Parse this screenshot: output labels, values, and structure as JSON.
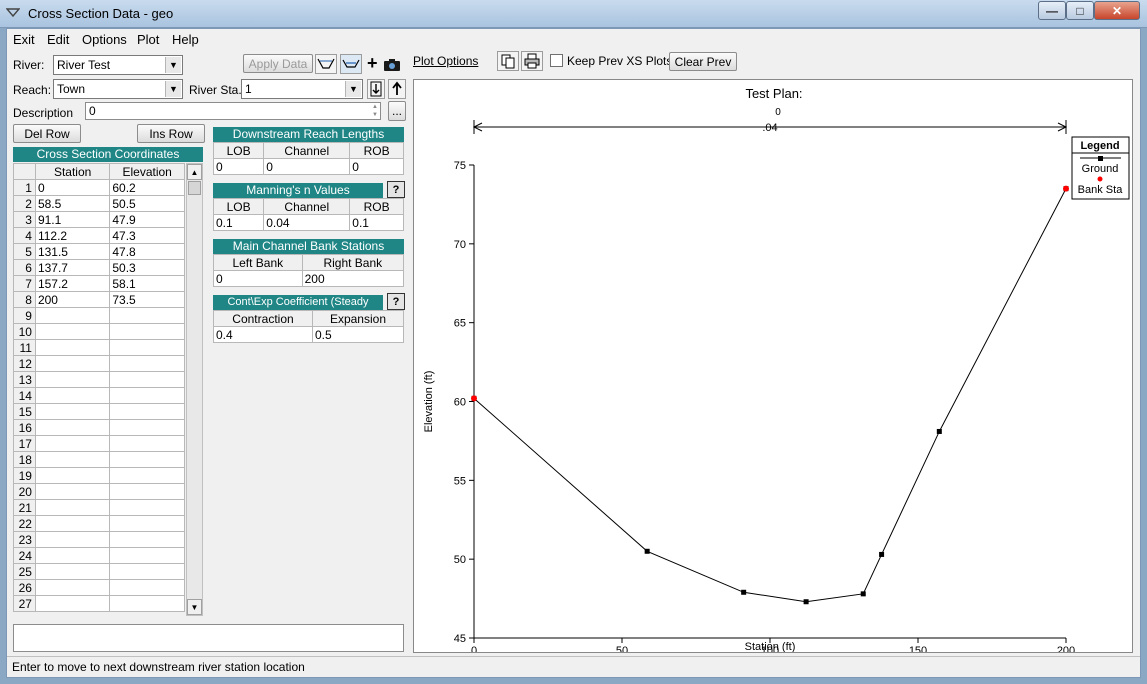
{
  "window": {
    "title": "Cross Section Data - geo"
  },
  "menu": [
    "Exit",
    "Edit",
    "Options",
    "Plot",
    "Help"
  ],
  "river": {
    "label": "River:",
    "value": "River Test"
  },
  "reach": {
    "label": "Reach:",
    "value": "Town"
  },
  "river_sta": {
    "label": "River Sta.:",
    "value": "1"
  },
  "apply_data_label": "Apply Data",
  "description": {
    "label": "Description",
    "value": "0"
  },
  "del_row_label": "Del Row",
  "ins_row_label": "Ins Row",
  "coords": {
    "header": "Cross Section Coordinates",
    "col_station": "Station",
    "col_elevation": "Elevation",
    "rows": [
      {
        "n": "1",
        "station": "0",
        "elevation": "60.2"
      },
      {
        "n": "2",
        "station": "58.5",
        "elevation": "50.5"
      },
      {
        "n": "3",
        "station": "91.1",
        "elevation": "47.9"
      },
      {
        "n": "4",
        "station": "112.2",
        "elevation": "47.3"
      },
      {
        "n": "5",
        "station": "131.5",
        "elevation": "47.8"
      },
      {
        "n": "6",
        "station": "137.7",
        "elevation": "50.3"
      },
      {
        "n": "7",
        "station": "157.2",
        "elevation": "58.1"
      },
      {
        "n": "8",
        "station": "200",
        "elevation": "73.5"
      },
      {
        "n": "9",
        "station": "",
        "elevation": ""
      },
      {
        "n": "10",
        "station": "",
        "elevation": ""
      },
      {
        "n": "11",
        "station": "",
        "elevation": ""
      },
      {
        "n": "12",
        "station": "",
        "elevation": ""
      },
      {
        "n": "13",
        "station": "",
        "elevation": ""
      },
      {
        "n": "14",
        "station": "",
        "elevation": ""
      },
      {
        "n": "15",
        "station": "",
        "elevation": ""
      },
      {
        "n": "16",
        "station": "",
        "elevation": ""
      },
      {
        "n": "17",
        "station": "",
        "elevation": ""
      },
      {
        "n": "18",
        "station": "",
        "elevation": ""
      },
      {
        "n": "19",
        "station": "",
        "elevation": ""
      },
      {
        "n": "20",
        "station": "",
        "elevation": ""
      },
      {
        "n": "21",
        "station": "",
        "elevation": ""
      },
      {
        "n": "22",
        "station": "",
        "elevation": ""
      },
      {
        "n": "23",
        "station": "",
        "elevation": ""
      },
      {
        "n": "24",
        "station": "",
        "elevation": ""
      },
      {
        "n": "25",
        "station": "",
        "elevation": ""
      },
      {
        "n": "26",
        "station": "",
        "elevation": ""
      },
      {
        "n": "27",
        "station": "",
        "elevation": ""
      }
    ]
  },
  "reach_lengths": {
    "header": "Downstream Reach Lengths",
    "cols": [
      "LOB",
      "Channel",
      "ROB"
    ],
    "values": [
      "0",
      "0",
      "0"
    ]
  },
  "mannings": {
    "header": "Manning's n Values",
    "cols": [
      "LOB",
      "Channel",
      "ROB"
    ],
    "values": [
      "0.1",
      "0.04",
      "0.1"
    ]
  },
  "bank_stations": {
    "header": "Main Channel Bank Stations",
    "cols": [
      "Left Bank",
      "Right Bank"
    ],
    "values": [
      "0",
      "200"
    ]
  },
  "coefficients": {
    "header": "Cont\\Exp Coefficient (Steady Flow)",
    "cols": [
      "Contraction",
      "Expansion"
    ],
    "values": [
      "0.4",
      "0.5"
    ]
  },
  "help_label": "?",
  "plot_toolbar": {
    "plot_options": "Plot Options",
    "keep_prev": "Keep Prev XS Plots",
    "clear_prev": "Clear Prev"
  },
  "status": "Enter to move to next downstream river station location",
  "chart_data": {
    "type": "line",
    "title": "Test      Plan:",
    "subtitle": "0",
    "annotation": ".04",
    "xlabel": "Station (ft)",
    "ylabel": "Elevation (ft)",
    "xlim": [
      0,
      200
    ],
    "ylim": [
      45,
      75
    ],
    "xticks": [
      0,
      50,
      100,
      150,
      200
    ],
    "yticks": [
      45,
      50,
      55,
      60,
      65,
      70,
      75
    ],
    "series": [
      {
        "name": "Ground",
        "x": [
          0,
          58.5,
          91.1,
          112.2,
          131.5,
          137.7,
          157.2,
          200
        ],
        "y": [
          60.2,
          50.5,
          47.9,
          47.3,
          47.8,
          50.3,
          58.1,
          73.5
        ]
      },
      {
        "name": "Bank Sta",
        "x": [
          0,
          200
        ],
        "y": [
          60.2,
          73.5
        ]
      }
    ],
    "legend_title": "Legend",
    "legend_placement": "top-right",
    "ground_color": "#000000",
    "bank_color": "#ff0000"
  }
}
